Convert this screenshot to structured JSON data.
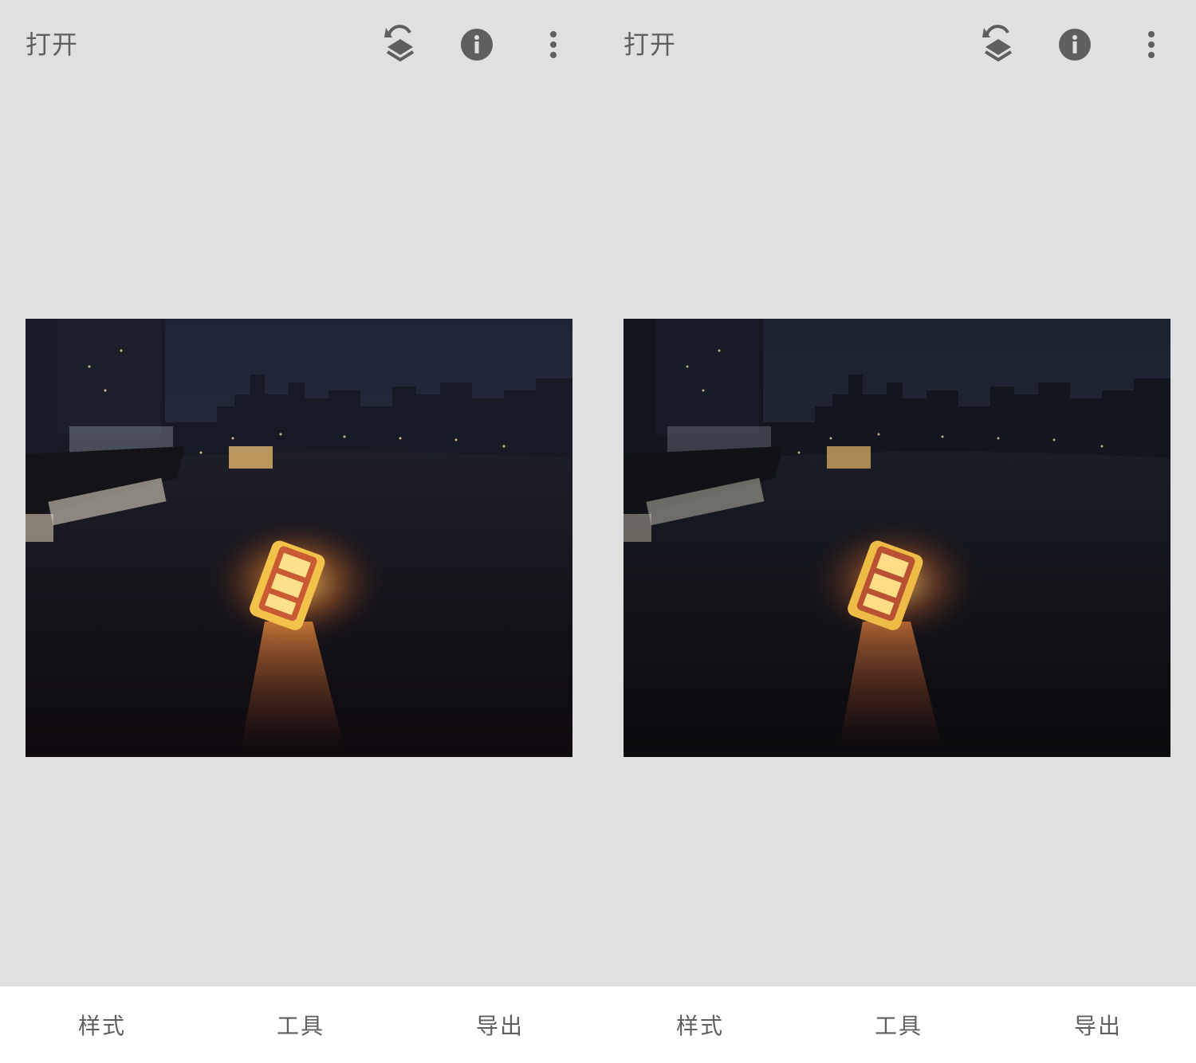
{
  "panels": [
    {
      "open_label": "打开",
      "icons": {
        "layers": "undo-layers-icon",
        "info": "info-icon",
        "more": "more-vert-icon"
      },
      "image": {
        "description_name": "night-river-cruise-photo",
        "variant": "original"
      },
      "nav": {
        "styles": "样式",
        "tools": "工具",
        "export": "导出"
      }
    },
    {
      "open_label": "打开",
      "icons": {
        "layers": "undo-layers-icon",
        "info": "info-icon",
        "more": "more-vert-icon"
      },
      "image": {
        "description_name": "night-river-cruise-photo",
        "variant": "edited"
      },
      "nav": {
        "styles": "样式",
        "tools": "工具",
        "export": "导出"
      }
    }
  ],
  "colors": {
    "background": "#e0e0e0",
    "icon": "#5f5f5f",
    "bottom_bar": "#ffffff"
  }
}
